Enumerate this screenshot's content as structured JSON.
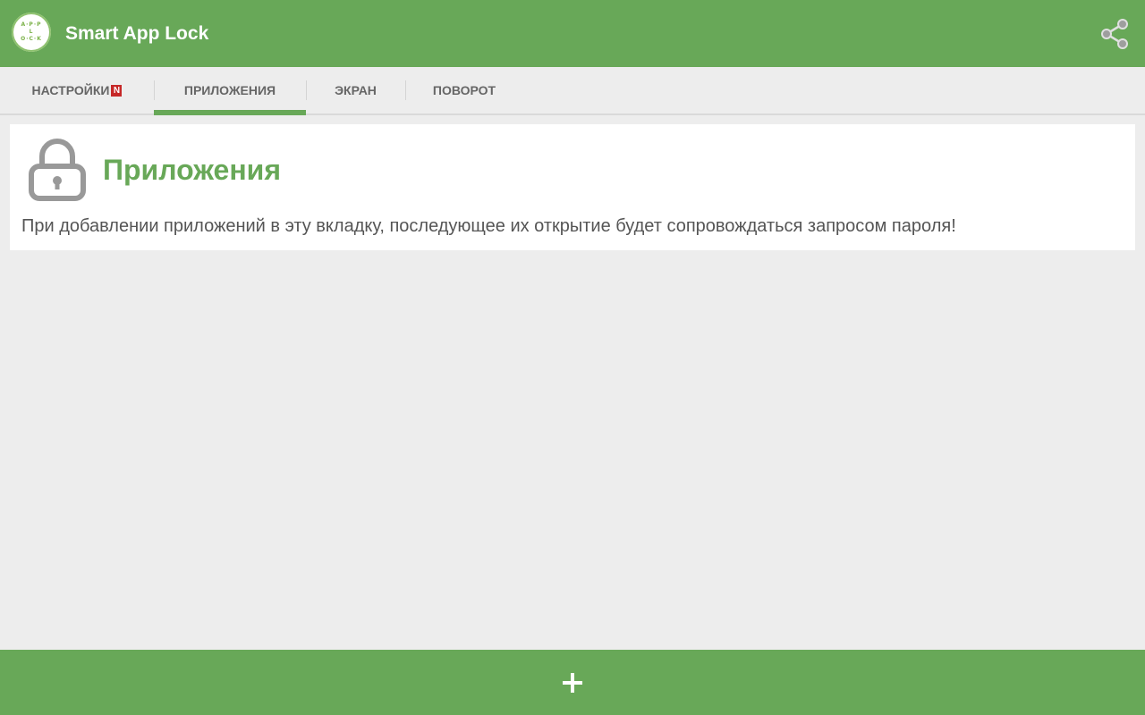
{
  "colors": {
    "accent": "#68a858",
    "background": "#ededed",
    "card": "#ffffff",
    "badge": "#c62828",
    "text_secondary": "#555555"
  },
  "appbar": {
    "title": "Smart App Lock",
    "logo_lines": [
      "A·P·P",
      "L",
      "O·C·K"
    ],
    "share_icon": "share-icon"
  },
  "tabs": [
    {
      "label": "НАСТРОЙКИ",
      "badge": "N"
    },
    {
      "label": "ПРИЛОЖЕНИЯ"
    },
    {
      "label": "ЭКРАН"
    },
    {
      "label": "ПОВОРОТ"
    }
  ],
  "active_tab": "ПРИЛОЖЕНИЯ",
  "card": {
    "icon": "lock-icon",
    "title": "Приложения",
    "description": "При добавлении приложений в эту вкладку, последующее их открытие будет сопровождаться запросом пароля!"
  },
  "bottom_bar": {
    "icon": "plus-icon"
  }
}
